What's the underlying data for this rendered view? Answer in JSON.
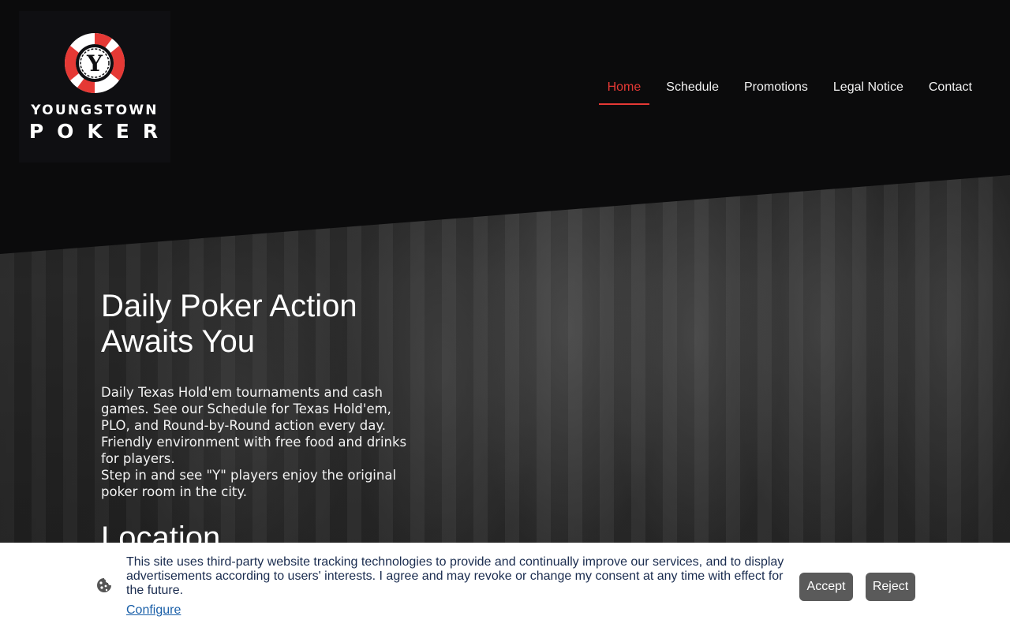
{
  "logo": {
    "line1": "YOUNGSTOWN",
    "line2": "POKER",
    "chip_letter": "Y",
    "colors": {
      "red": "#e53935",
      "white": "#ffffff",
      "black": "#0f0f12"
    }
  },
  "nav": {
    "items": [
      {
        "label": "Home",
        "active": true
      },
      {
        "label": "Schedule",
        "active": false
      },
      {
        "label": "Promotions",
        "active": false
      },
      {
        "label": "Legal Notice",
        "active": false
      },
      {
        "label": "Contact",
        "active": false
      }
    ],
    "accent_color": "#e53935"
  },
  "hero": {
    "title_line1": "Daily Poker Action",
    "title_line2": "Awaits You",
    "paragraph": [
      "Daily Texas Hold'em tournaments and cash games. See our Schedule for Texas Hold'em, PLO, and Round-by-Round action every day.",
      "Friendly environment with free food and drinks for players.",
      "Step in and see \"Y\" players enjoy the original poker room in the city."
    ],
    "next_heading": "Location"
  },
  "cookie_banner": {
    "icon": "cookie-icon",
    "text": "This site uses third-party website tracking technologies to provide and continually improve our services, and to display advertisements according to users' interests. I agree and may revoke or change my consent at any time with effect for the future.",
    "configure_label": "Configure",
    "accept_label": "Accept",
    "reject_label": "Reject"
  }
}
